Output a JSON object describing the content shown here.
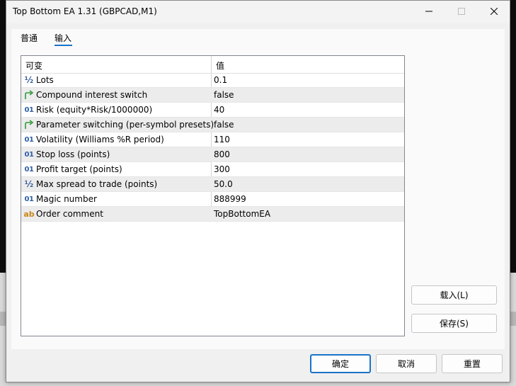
{
  "window": {
    "title": "Top Bottom EA  1.31 (GBPCAD,M1)"
  },
  "tabs": [
    {
      "label": "普通"
    },
    {
      "label": "输入"
    }
  ],
  "grid": {
    "headers": {
      "variable": "可变",
      "value": "值"
    },
    "rows": [
      {
        "icon": "half-icon",
        "name": "Lots",
        "value": "0.1"
      },
      {
        "icon": "toggle-arrow-icon",
        "name": "Compound interest switch",
        "value": "false"
      },
      {
        "icon": "int-icon",
        "name": "Risk (equity*Risk/1000000)",
        "value": "40"
      },
      {
        "icon": "toggle-arrow-icon",
        "name": "Parameter switching (per-symbol presets)",
        "value": "false"
      },
      {
        "icon": "int-icon",
        "name": "Volatility (Williams %R period)",
        "value": "110"
      },
      {
        "icon": "int-icon",
        "name": "Stop loss (points)",
        "value": "800"
      },
      {
        "icon": "int-icon",
        "name": "Profit target (points)",
        "value": "300"
      },
      {
        "icon": "half-icon",
        "name": "Max spread to trade (points)",
        "value": "50.0"
      },
      {
        "icon": "int-icon",
        "name": "Magic number",
        "value": "888999"
      },
      {
        "icon": "string-icon",
        "name": "Order comment",
        "value": "TopBottomEA"
      }
    ]
  },
  "icon_glyphs": {
    "half": "½",
    "int": "01",
    "string": "ab"
  },
  "side_buttons": {
    "load": "载入(L)",
    "save": "保存(S)"
  },
  "footer_buttons": {
    "ok": "确定",
    "cancel": "取消",
    "reset": "重置"
  },
  "colors": {
    "accent": "#1a73c8",
    "toggle_icon": "#2e9b3a"
  }
}
